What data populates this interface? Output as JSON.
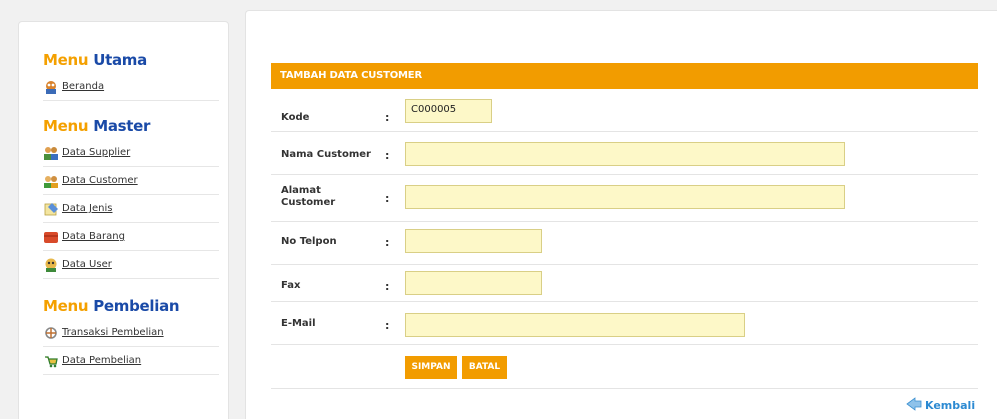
{
  "sidebar": {
    "menu_utama": {
      "accent": "Menu",
      "rest": " Utama"
    },
    "menu_master": {
      "accent": "Menu",
      "rest": " Master"
    },
    "menu_pembelian": {
      "accent": "Menu",
      "rest": " Pembelian"
    },
    "utama_items": [
      {
        "label": "Beranda",
        "icon": "home-icon"
      }
    ],
    "master_items": [
      {
        "label": "Data Supplier",
        "icon": "supplier-icon"
      },
      {
        "label": "Data Customer",
        "icon": "customer-icon"
      },
      {
        "label": "Data Jenis",
        "icon": "category-icon"
      },
      {
        "label": "Data Barang",
        "icon": "box-icon"
      },
      {
        "label": "Data User",
        "icon": "user-icon"
      }
    ],
    "pembelian_items": [
      {
        "label": "Transaksi Pembelian",
        "icon": "transaction-icon"
      },
      {
        "label": "Data Pembelian",
        "icon": "purchase-icon"
      }
    ]
  },
  "form": {
    "header": "TAMBAH DATA CUSTOMER",
    "colon": ":",
    "kode_label": "Kode",
    "kode_value": "C000005",
    "nama_label": "Nama Customer",
    "nama_value": "",
    "alamat_label_line1": "Alamat",
    "alamat_label_line2": "Customer",
    "alamat_value": "",
    "telpon_label": "No Telpon",
    "telpon_value": "",
    "fax_label": "Fax",
    "fax_value": "",
    "email_label": "E-Mail",
    "email_value": "",
    "save_label": "SIMPAN",
    "cancel_label": "BATAL",
    "back_label": "Kembali"
  },
  "colors": {
    "accent": "#f29c00",
    "heading_blue": "#1a4aa7",
    "heading_orange": "#f4a000",
    "field_bg": "#fdf8c8",
    "link_blue": "#2c8ad2"
  }
}
